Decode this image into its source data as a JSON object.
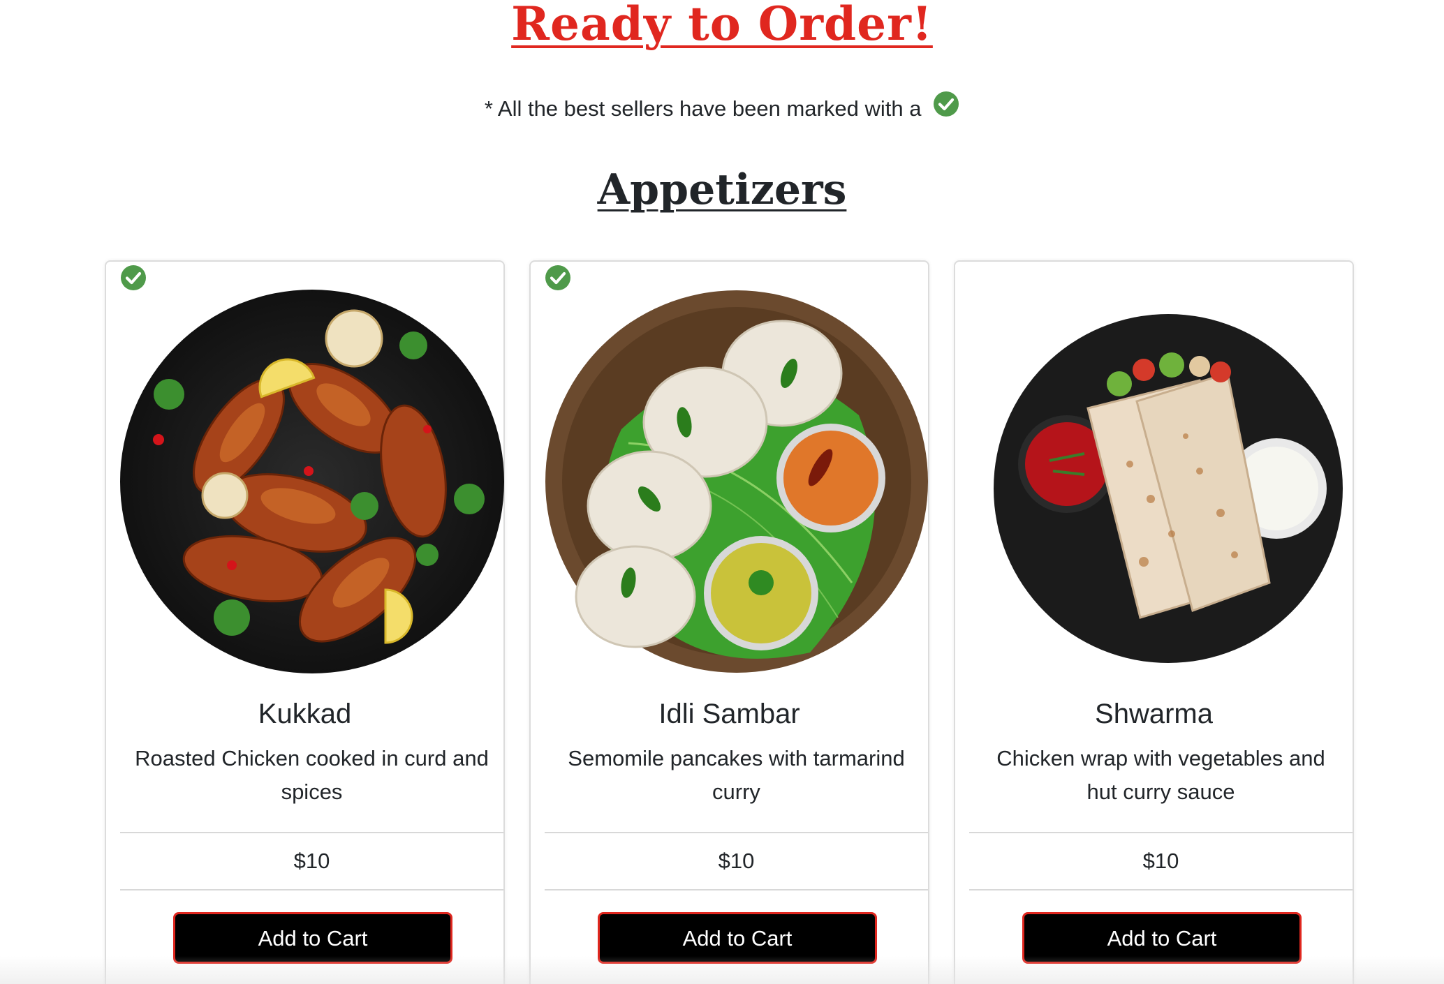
{
  "page": {
    "title": "Ready to Order!",
    "note_text": "* All the best sellers have been marked with a",
    "note_icon": "check-circle-icon",
    "section_title": "Appetizers",
    "accent_color": "#e0271f",
    "check_color": "#4f9a4a"
  },
  "cards": [
    {
      "name": "Kukkad",
      "description": "Roasted Chicken cooked in curd and spices",
      "price": "$10",
      "button_label": "Add to Cart",
      "best_seller": true,
      "image": "roasted-chicken-plate"
    },
    {
      "name": "Idli Sambar",
      "description": "Semomile pancakes with tarmarind curry",
      "price": "$10",
      "button_label": "Add to Cart",
      "best_seller": true,
      "image": "idli-sambar-plate"
    },
    {
      "name": "Shwarma",
      "description": "Chicken wrap with vegetables and hut curry sauce",
      "price": "$10",
      "button_label": "Add to Cart",
      "best_seller": false,
      "image": "shwarma-wrap-plate"
    }
  ]
}
